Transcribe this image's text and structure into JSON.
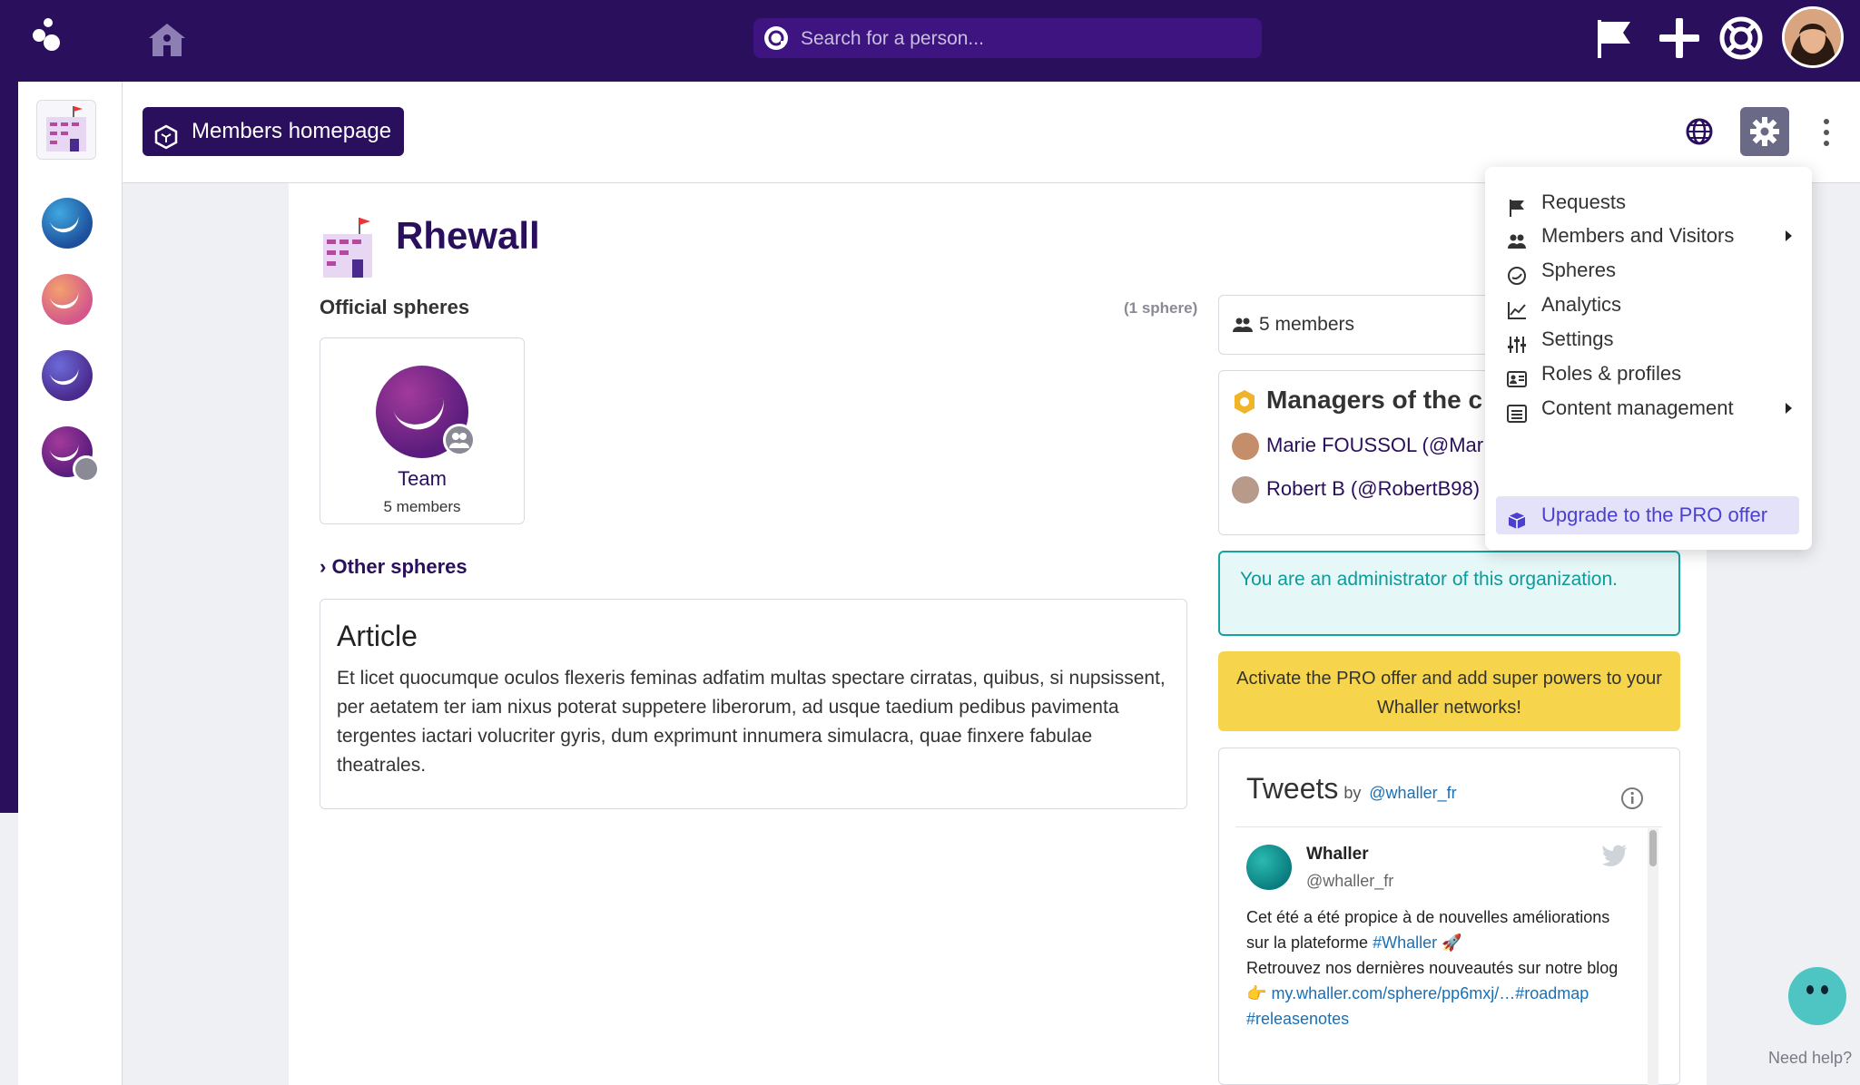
{
  "search": {
    "placeholder": "Search for a person..."
  },
  "header": {
    "members_homepage": "Members homepage"
  },
  "org": {
    "name": "Rhewall",
    "official_spheres_title": "Official spheres",
    "sphere_count": "(1 sphere)",
    "team": {
      "name": "Team",
      "members": "5 members"
    },
    "other_spheres": "Other spheres"
  },
  "article": {
    "title": "Article",
    "body": "Et licet quocumque oculos flexeris feminas adfatim multas spectare cirratas, quibus, si nupsissent, per aetatem ter iam nixus poterat suppetere liberorum, ad usque taedium pedibus pavimenta tergentes iactari volucriter gyris, dum exprimunt innumera simulacra, quae finxere fabulae theatrales."
  },
  "right": {
    "members_count": "5 members",
    "managers_title": "Managers of the c",
    "managers": [
      {
        "name": "Marie FOUSSOL (@Mar"
      },
      {
        "name": "Robert B (@RobertB98)"
      }
    ],
    "admin_notice": "You are an administrator of this organization.",
    "pro_notice": "Activate the PRO offer and add super powers to your Whaller networks!"
  },
  "tweets": {
    "title": "Tweets",
    "by": "by",
    "account_link": "@whaller_fr",
    "tweet": {
      "author": "Whaller",
      "handle": "@whaller_fr",
      "text_1": "Cet été a été propice à de nouvelles améliorations sur la plateforme",
      "hashtag_1": "#Whaller",
      "text_2": "Retrouvez nos dernières nouveautés sur notre blog",
      "link": "my.whaller.com/sphere/pp6mxj/…#roadmap",
      "hashtag_2": "#releasenotes"
    }
  },
  "menu": {
    "items": [
      {
        "label": "Requests",
        "icon": "flag-icon"
      },
      {
        "label": "Members and Visitors",
        "icon": "users-icon",
        "submenu": true
      },
      {
        "label": "Spheres",
        "icon": "sphere-icon"
      },
      {
        "label": "Analytics",
        "icon": "chart-icon"
      },
      {
        "label": "Settings",
        "icon": "sliders-icon"
      },
      {
        "label": "Roles & profiles",
        "icon": "id-card-icon"
      },
      {
        "label": "Content management",
        "icon": "list-icon",
        "submenu": true
      },
      {
        "label": "Upgrade to the PRO offer",
        "icon": "cube-icon",
        "highlighted": true
      }
    ]
  },
  "help": {
    "label": "Need help?"
  },
  "colors": {
    "brand_dark": "#2a0f5c",
    "admin_teal": "#17a2a2",
    "pro_yellow": "#f6d54c",
    "pro_highlight": "#e4e2f8"
  }
}
